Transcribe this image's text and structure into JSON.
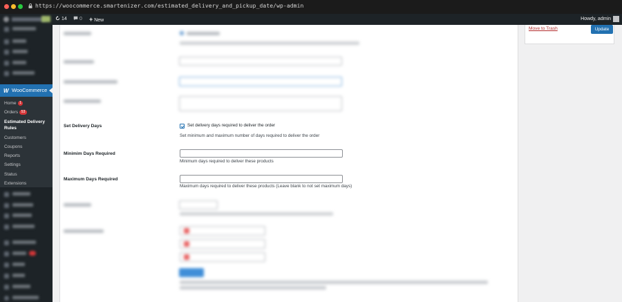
{
  "browser": {
    "url": "https://woocommerce.smartenizer.com/estimated_delivery_and_pickup_date/wp-admin",
    "dots": [
      "#ff5f57",
      "#febc2e",
      "#28c840"
    ]
  },
  "adminbar": {
    "updates_count": "14",
    "comments_count": "0",
    "new_label": "New",
    "howdy": "Howdy, admin"
  },
  "sidebar": {
    "woocommerce_label": "WooCommerce",
    "submenu": [
      {
        "label": "Home",
        "badge": "1"
      },
      {
        "label": "Orders",
        "badge": "53"
      },
      {
        "label": "Estimated Delivery Rules",
        "current": true
      },
      {
        "label": "Customers"
      },
      {
        "label": "Coupons"
      },
      {
        "label": "Reports"
      },
      {
        "label": "Settings"
      },
      {
        "label": "Status"
      },
      {
        "label": "Extensions"
      }
    ]
  },
  "form": {
    "set_delivery_days": {
      "label": "Set Delivery Days",
      "checkbox_label": "Set delivery days required to deliver the order",
      "checked": true,
      "description": "Set minimum and maximum number of days required to deliver the order"
    },
    "min_days": {
      "label": "Minimim Days Required",
      "value": "",
      "description": "Minimum days required to deliver these products"
    },
    "max_days": {
      "label": "Maximum Days Required",
      "value": "",
      "description": "Maximum days required to deliver these products (Leave blank to not set maximum days)"
    }
  },
  "publish_box": {
    "trash_label": "Move to Trash",
    "update_label": "Update"
  },
  "colors": {
    "admin_dark": "#1d2327",
    "accent": "#2271b1",
    "badge": "#d63638",
    "trash": "#b32d2e"
  }
}
